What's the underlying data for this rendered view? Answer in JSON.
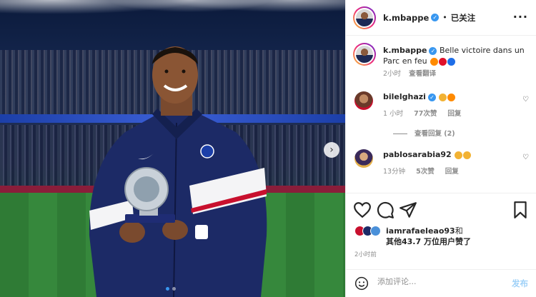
{
  "post": {
    "username": "k.mbappe",
    "follow_status": "已关注",
    "separator": "•",
    "more": "···"
  },
  "caption": {
    "username": "k.mbappe",
    "text": "Belle victoire dans un Parc en feu",
    "time": "2小时",
    "see_translation": "查看翻译"
  },
  "comments": [
    {
      "username": "bilelghazi",
      "time": "1 小时",
      "likes": "77次赞",
      "reply": "回复",
      "view_replies": "查看回复 (2)"
    },
    {
      "username": "pablosarabia92",
      "time": "13分钟",
      "likes": "5次赞",
      "reply": "回复"
    }
  ],
  "likes": {
    "first_user": "iamrafaeleao93",
    "conj": "和",
    "others": "其他43.7 万位用户赞了"
  },
  "posted_ago": "2小时前",
  "add_comment": {
    "placeholder": "添加评论...",
    "post_label": "发布"
  },
  "colors": {
    "accent": "#3897f0",
    "post_btn_disabled": "#9fd1f8",
    "text": "#262626",
    "muted": "#8e8e8e"
  }
}
